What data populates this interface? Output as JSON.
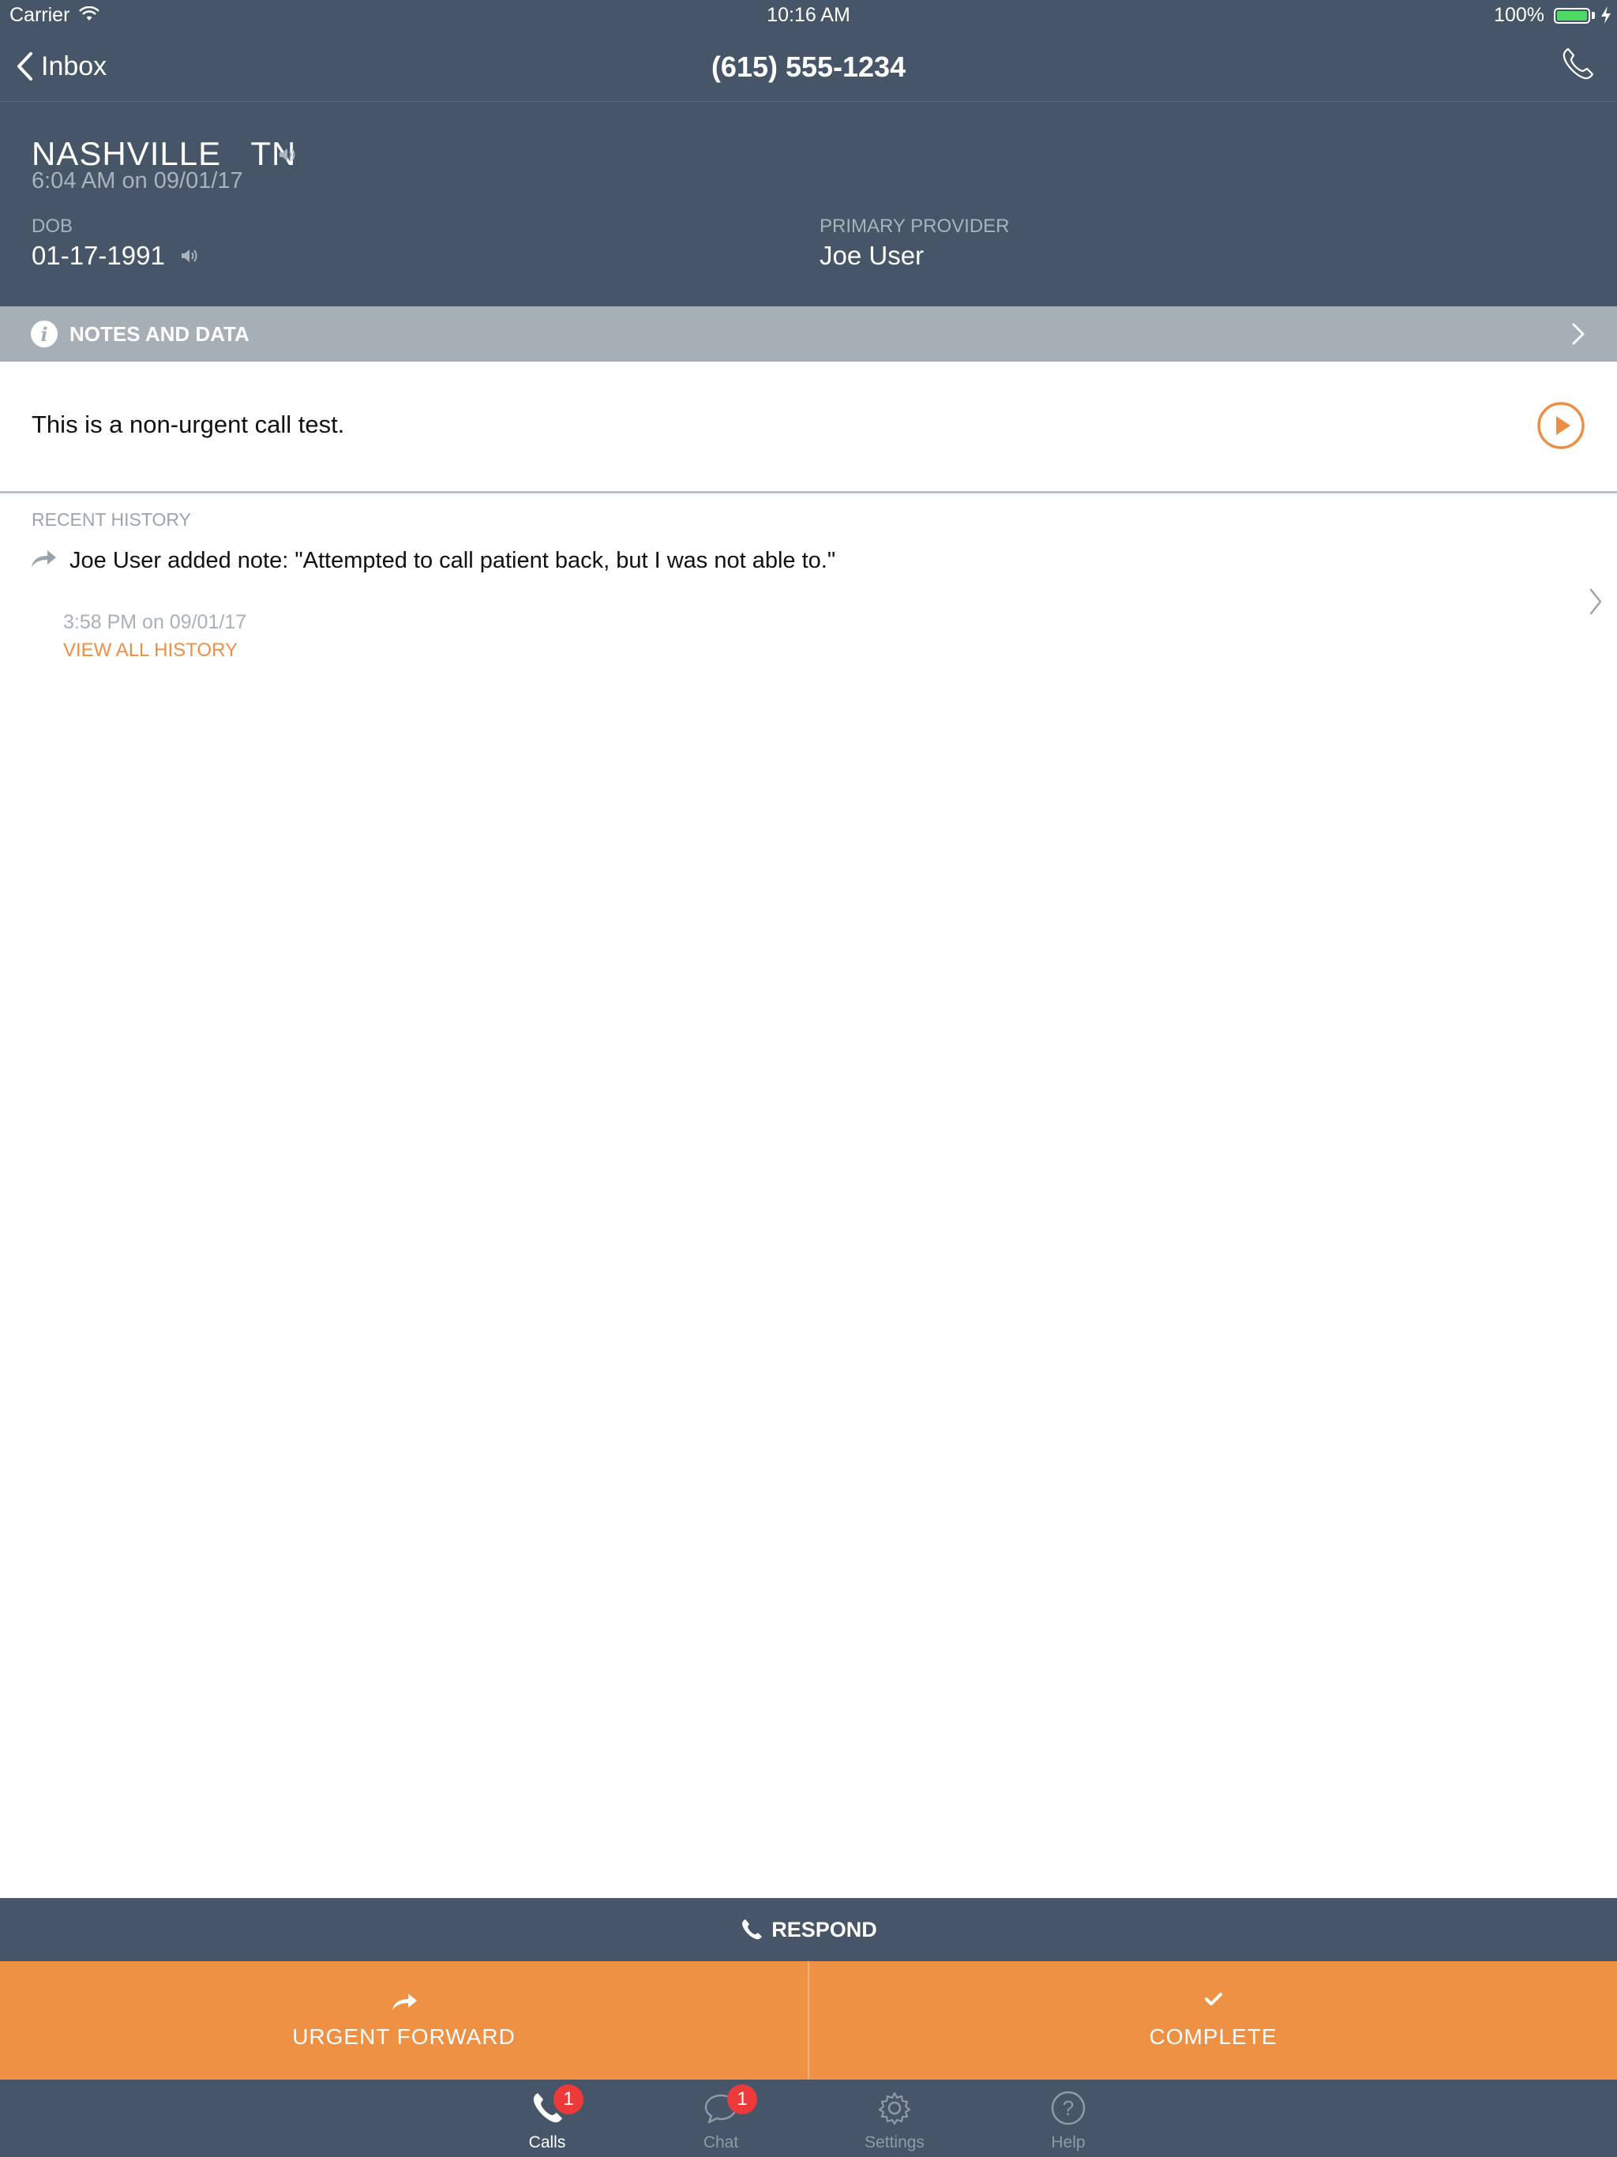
{
  "status_bar": {
    "carrier": "Carrier",
    "time": "10:16 AM",
    "battery": "100%"
  },
  "nav": {
    "back_label": "Inbox",
    "title": "(615) 555-1234"
  },
  "patient": {
    "location": "NASHVILLE   TN",
    "call_time": "6:04 AM on 09/01/17",
    "dob_label": "DOB",
    "dob": "01-17-1991",
    "provider_label": "PRIMARY PROVIDER",
    "provider": "Joe User"
  },
  "notes": {
    "label": "NOTES AND DATA"
  },
  "message": {
    "text": "This is a non-urgent call test."
  },
  "history": {
    "label": "RECENT HISTORY",
    "entry_note": "Joe User added note: \"Attempted to call patient back, but I was not able to.\"",
    "entry_time": "3:58 PM on 09/01/17",
    "view_all": "VIEW ALL HISTORY"
  },
  "respond": {
    "label": "RESPOND"
  },
  "actions": {
    "urgent_forward": "URGENT FORWARD",
    "complete": "COMPLETE"
  },
  "tabs": [
    {
      "label": "Calls",
      "badge": "1",
      "icon": "phone-icon"
    },
    {
      "label": "Chat",
      "badge": "1",
      "icon": "chat-icon"
    },
    {
      "label": "Settings",
      "icon": "gear-icon"
    },
    {
      "label": "Help",
      "icon": "help-icon"
    }
  ],
  "colors": {
    "header": "#465668",
    "accent": "#ee9144",
    "notes_bar": "#a6aeb6",
    "badge": "#ec3a3a"
  }
}
